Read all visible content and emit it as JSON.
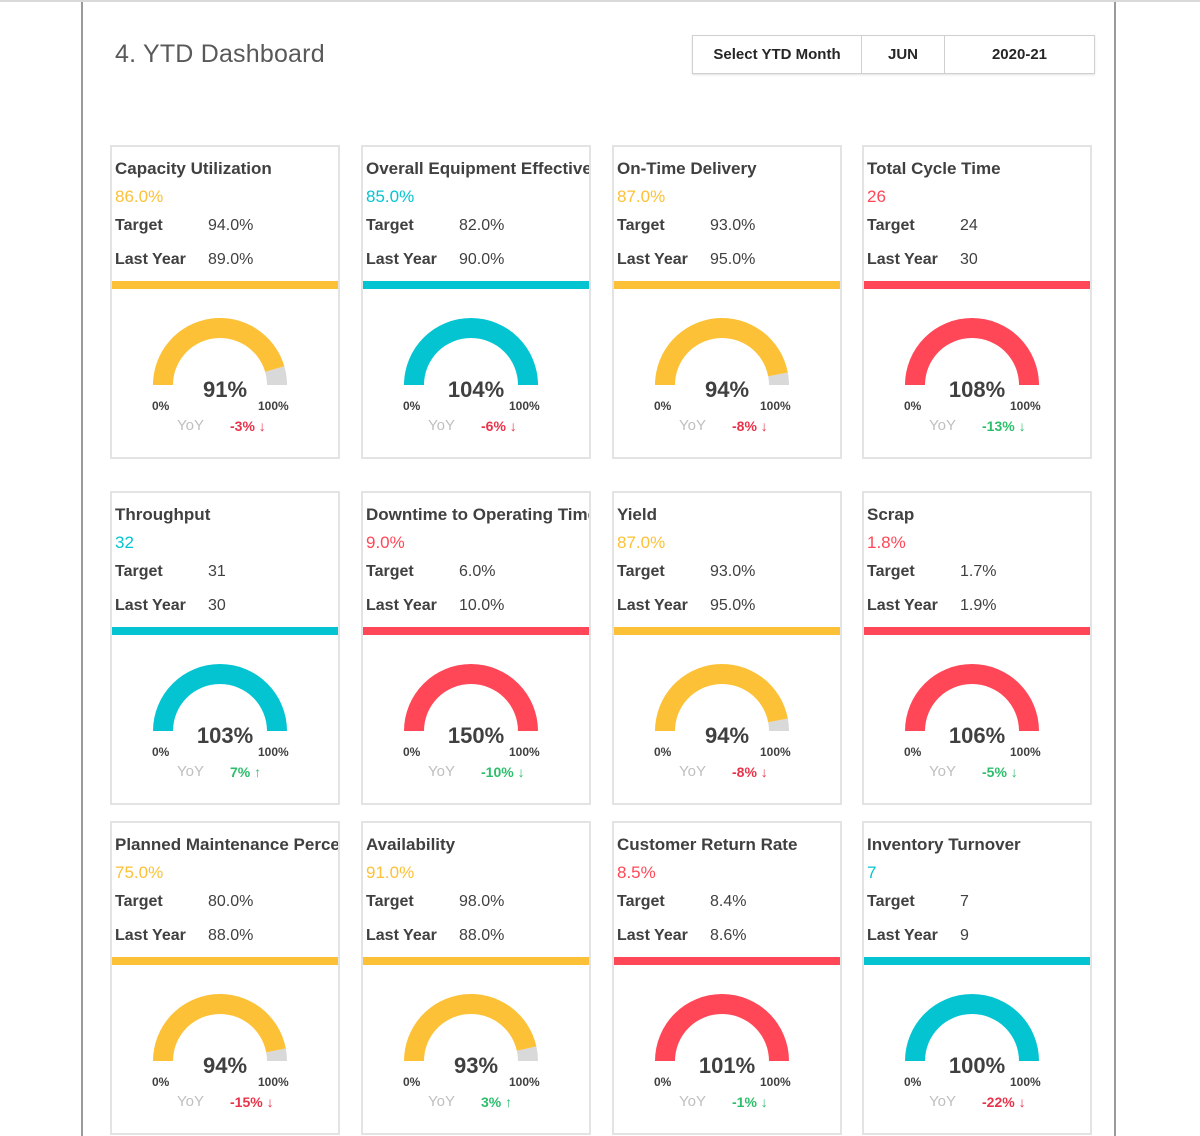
{
  "header": {
    "title": "4. YTD Dashboard",
    "selector_label": "Select YTD Month",
    "month": "JUN",
    "fiscal_year": "2020-21"
  },
  "colors": {
    "yellow": "#FCC137",
    "cyan": "#05C4D2",
    "red": "#FF4757",
    "gray_track": "#D9D9D9",
    "yoy_red": "#E8334A",
    "yoy_green": "#2DBE6C"
  },
  "common": {
    "target_label": "Target",
    "last_year_label": "Last Year",
    "yoy_label": "YoY",
    "gauge_min": "0%",
    "gauge_max": "100%"
  },
  "kpis": [
    {
      "title": "Capacity Utilization",
      "value": "86.0%",
      "target": "94.0%",
      "last_year": "89.0%",
      "color": "yellow",
      "gauge_text": "91%",
      "gauge_fraction": 0.91,
      "yoy": "-3% ↓",
      "yoy_color": "red"
    },
    {
      "title": "Overall Equipment Effectiveness",
      "value": "85.0%",
      "target": "82.0%",
      "last_year": "90.0%",
      "color": "cyan",
      "gauge_text": "104%",
      "gauge_fraction": 1.04,
      "yoy": "-6% ↓",
      "yoy_color": "red"
    },
    {
      "title": "On-Time Delivery",
      "value": "87.0%",
      "target": "93.0%",
      "last_year": "95.0%",
      "color": "yellow",
      "gauge_text": "94%",
      "gauge_fraction": 0.94,
      "yoy": "-8% ↓",
      "yoy_color": "red"
    },
    {
      "title": "Total Cycle Time",
      "value": "26",
      "target": "24",
      "last_year": "30",
      "color": "red",
      "gauge_text": "108%",
      "gauge_fraction": 1.08,
      "yoy": "-13% ↓",
      "yoy_color": "green"
    },
    {
      "title": "Throughput",
      "value": "32",
      "target": "31",
      "last_year": "30",
      "color": "cyan",
      "gauge_text": "103%",
      "gauge_fraction": 1.03,
      "yoy": "7% ↑",
      "yoy_color": "green"
    },
    {
      "title": "Downtime to Operating Time",
      "value": "9.0%",
      "target": "6.0%",
      "last_year": "10.0%",
      "color": "red",
      "gauge_text": "150%",
      "gauge_fraction": 1.5,
      "yoy": "-10% ↓",
      "yoy_color": "green"
    },
    {
      "title": "Yield",
      "value": "87.0%",
      "target": "93.0%",
      "last_year": "95.0%",
      "color": "yellow",
      "gauge_text": "94%",
      "gauge_fraction": 0.94,
      "yoy": "-8% ↓",
      "yoy_color": "red"
    },
    {
      "title": "Scrap",
      "value": "1.8%",
      "target": "1.7%",
      "last_year": "1.9%",
      "color": "red",
      "gauge_text": "106%",
      "gauge_fraction": 1.06,
      "yoy": "-5% ↓",
      "yoy_color": "green"
    },
    {
      "title": "Planned Maintenance Percentage",
      "value": "75.0%",
      "target": "80.0%",
      "last_year": "88.0%",
      "color": "yellow",
      "gauge_text": "94%",
      "gauge_fraction": 0.94,
      "yoy": "-15% ↓",
      "yoy_color": "red"
    },
    {
      "title": "Availability",
      "value": "91.0%",
      "target": "98.0%",
      "last_year": "88.0%",
      "color": "yellow",
      "gauge_text": "93%",
      "gauge_fraction": 0.93,
      "yoy": "3% ↑",
      "yoy_color": "green"
    },
    {
      "title": "Customer Return Rate",
      "value": "8.5%",
      "target": "8.4%",
      "last_year": "8.6%",
      "color": "red",
      "gauge_text": "101%",
      "gauge_fraction": 1.01,
      "yoy": "-1% ↓",
      "yoy_color": "green"
    },
    {
      "title": "Inventory Turnover",
      "value": "7",
      "target": "7",
      "last_year": "9",
      "color": "cyan",
      "gauge_text": "100%",
      "gauge_fraction": 1.0,
      "yoy": "-22% ↓",
      "yoy_color": "red"
    }
  ]
}
